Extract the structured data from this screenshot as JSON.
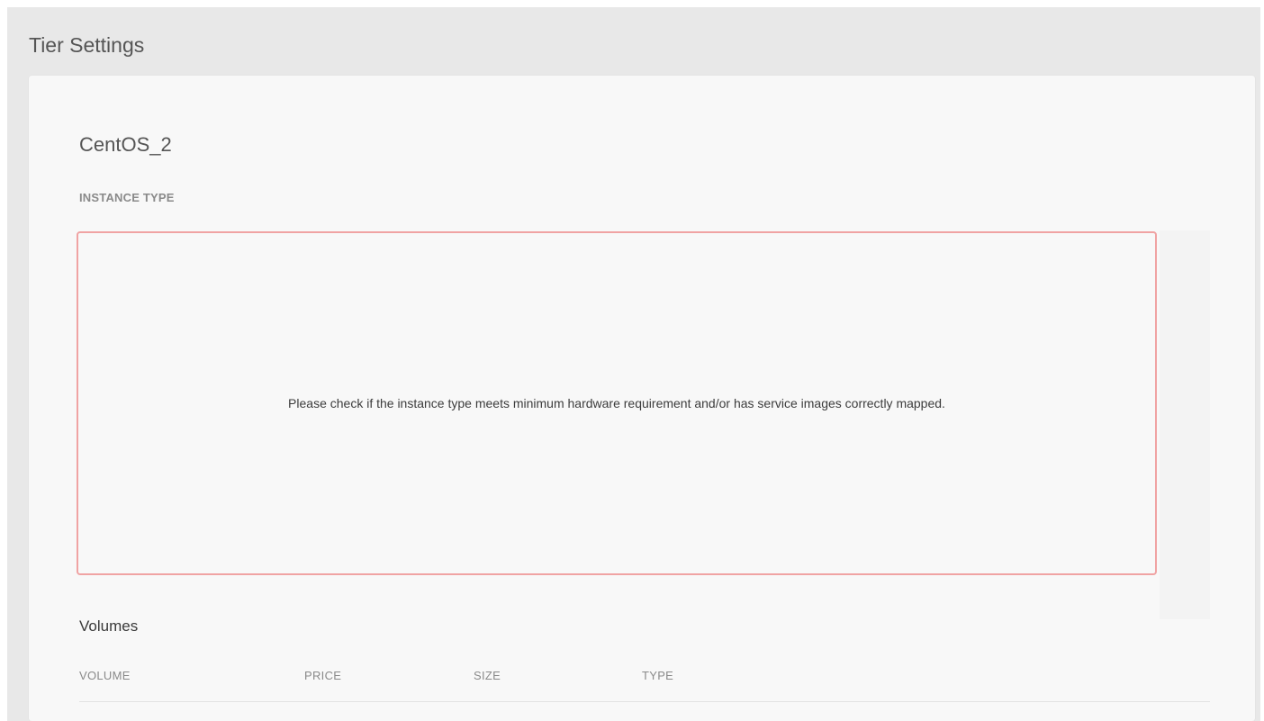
{
  "header": {
    "title": "Tier Settings"
  },
  "tier": {
    "name": "CentOS_2"
  },
  "instance_type": {
    "label": "INSTANCE TYPE",
    "error_message": "Please check if the instance type meets minimum hardware requirement and/or has service images correctly mapped."
  },
  "volumes": {
    "heading": "Volumes",
    "columns": [
      "VOLUME",
      "PRICE",
      "SIZE",
      "TYPE"
    ],
    "rows": []
  },
  "colors": {
    "error_border": "#f0a3a3",
    "background": "#e8e8e8",
    "panel": "#f8f8f8"
  }
}
